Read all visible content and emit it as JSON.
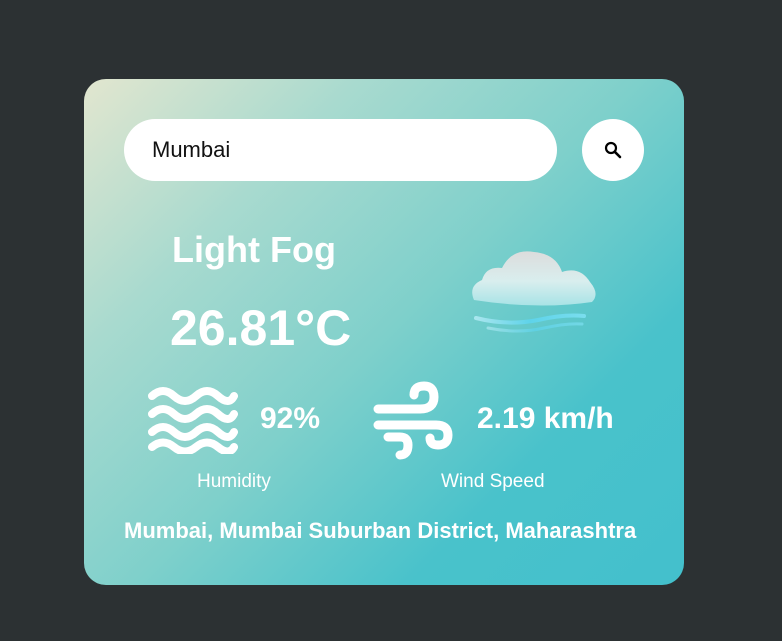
{
  "search": {
    "value": "Mumbai",
    "button_icon": "search-icon"
  },
  "weather": {
    "condition": "Light Fog",
    "temperature": "26.81°C",
    "icon": "fog-cloud-icon"
  },
  "stats": {
    "humidity": {
      "value": "92%",
      "label": "Humidity",
      "icon": "humidity-waves-icon"
    },
    "wind": {
      "value": "2.19 km/h",
      "label": "Wind Speed",
      "icon": "wind-icon"
    }
  },
  "location": "Mumbai, Mumbai Suburban District, Maharashtra",
  "colors": {
    "page_background": "#2c3133",
    "card_gradient_start": "#e2e6cf",
    "card_gradient_end": "#43c0cc",
    "text": "#ffffff"
  }
}
